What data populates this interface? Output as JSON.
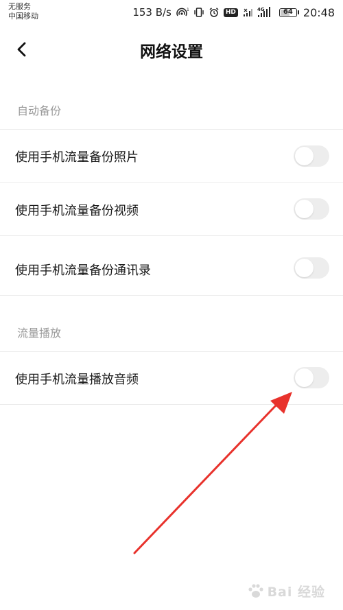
{
  "status_bar": {
    "carrier_line1": "无服务",
    "carrier_line2": "中国移动",
    "network_speed": "153 B/s",
    "hd_label": "HD",
    "network_type": "4G",
    "battery_level": "64",
    "battery_fraction": 0.64,
    "time": "20:48"
  },
  "header": {
    "title": "网络设置"
  },
  "sections": [
    {
      "header": "自动备份",
      "items": [
        {
          "label": "使用手机流量备份照片",
          "enabled": false
        },
        {
          "label": "使用手机流量备份视频",
          "enabled": false
        },
        {
          "label": "使用手机流量备份通讯录",
          "enabled": false
        }
      ]
    },
    {
      "header": "流量播放",
      "items": [
        {
          "label": "使用手机流量播放音频",
          "enabled": false
        }
      ]
    }
  ],
  "annotation": {
    "arrow_color": "#e8322c"
  },
  "watermark": {
    "text": "Bai 经验"
  }
}
